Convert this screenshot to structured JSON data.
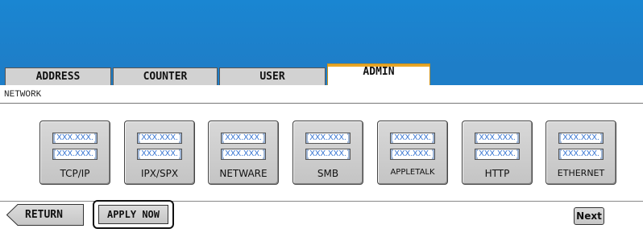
{
  "tabs": [
    {
      "label": "ADDRESS"
    },
    {
      "label": "COUNTER"
    },
    {
      "label": "USER"
    },
    {
      "label": "ADMIN",
      "active": true
    }
  ],
  "section_title": "NETWORK",
  "network_buttons": [
    {
      "label": "TCP/IP",
      "addr1": "XXX.XXX.",
      "addr2": "XXX.XXX."
    },
    {
      "label": "IPX/SPX",
      "addr1": "XXX.XXX.",
      "addr2": "XXX.XXX."
    },
    {
      "label": "NETWARE",
      "addr1": "XXX.XXX.",
      "addr2": "XXX.XXX."
    },
    {
      "label": "SMB",
      "addr1": "XXX.XXX.",
      "addr2": "XXX.XXX."
    },
    {
      "label": "APPLETALK",
      "addr1": "XXX.XXX.",
      "addr2": "XXX.XXX."
    },
    {
      "label": "HTTP",
      "addr1": "XXX.XXX.",
      "addr2": "XXX.XXX."
    },
    {
      "label": "ETHERNET",
      "addr1": "XXX.XXX.",
      "addr2": "XXX.XXX."
    }
  ],
  "footer": {
    "return_label": "RETURN",
    "apply_label": "APPLY NOW",
    "next_label": "Next"
  },
  "colors": {
    "header_blue": "#1e7ec8",
    "active_tab_accent": "#e8a626",
    "address_text": "#2f6fd0"
  }
}
